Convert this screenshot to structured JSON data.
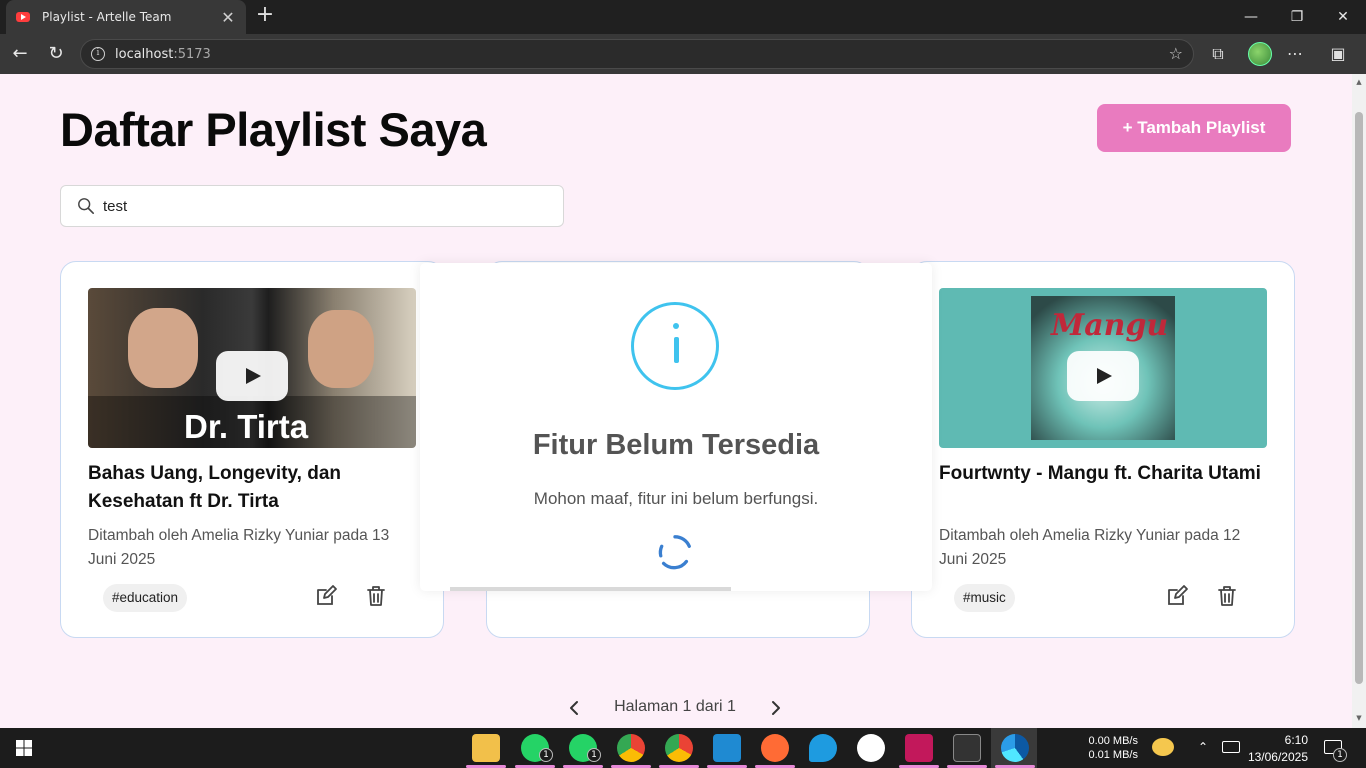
{
  "browser": {
    "tab_title": "Playlist - Artelle Team",
    "tab_close": "✕",
    "new_tab": "+",
    "url_host": "localhost",
    "url_port": ":5173",
    "window_minimize": "—",
    "window_restore": "❐",
    "window_close": "✕",
    "back": "←",
    "reload": "↻",
    "star": "☆",
    "extensions": "⧉",
    "more": "⋯",
    "sidebar": "▣"
  },
  "page": {
    "title": "Daftar Playlist Saya",
    "add_button": "+ Tambah Playlist",
    "search": {
      "value": "test",
      "placeholder": ""
    }
  },
  "cards": [
    {
      "title": "Bahas Uang, Longevity, dan Kesehatan ft Dr. Tirta",
      "meta": "Ditambah oleh Amelia Rizky Yuniar pada 13 Juni 2025",
      "tag": "#education",
      "thumb_caption": "Dr. Tirta"
    },
    {
      "title": "Fourtwnty - Mangu ft. Charita Utami",
      "meta": "Ditambah oleh Amelia Rizky Yuniar pada 12 Juni 2025",
      "tag": "#music",
      "thumb_caption": "Mangu"
    }
  ],
  "modal": {
    "title": "Fitur Belum Tersedia",
    "text": "Mohon maaf, fitur ini belum berfungsi.",
    "icon": "info-icon",
    "icon_color": "#3fc3ee"
  },
  "pagination": {
    "label": "Halaman 1 dari 1"
  },
  "taskbar": {
    "net_up": "0.00 MB/s",
    "net_down": "0.01 MB/s",
    "time": "6:10",
    "date": "13/06/2025",
    "badge_whatsapp_1": "1",
    "badge_whatsapp_2": "1",
    "notification_count": "1"
  },
  "colors": {
    "accent": "#e97bbf",
    "page_bg": "#fdf0f9",
    "card_border": "#c8d9f2"
  }
}
